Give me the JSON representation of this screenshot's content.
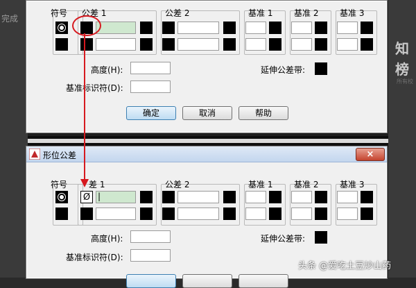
{
  "background": {
    "left_text": "完成",
    "right_text_1": "知",
    "right_text_2": "榜",
    "right_small_text": "所有校"
  },
  "labels": {
    "symbol": "符号",
    "tolerance1": "公差 1",
    "tolerance2": "公差 2",
    "datum1": "基准 1",
    "datum2": "基准 2",
    "datum3": "基准 3",
    "height": "高度(H):",
    "datum_identifier": "基准标识符(D):",
    "projected_tolerance_zone": "延伸公差带:"
  },
  "buttons": {
    "ok": "确定",
    "cancel": "取消",
    "help": "帮助"
  },
  "dialog2": {
    "title": "形位公差",
    "close": "×",
    "tolerance1_prefix": "差 1",
    "diameter_symbol": "Ø",
    "tolerance1_value": "|"
  },
  "watermark": "头条 @爱吃土豆炒山药",
  "colors": {
    "annotation": "#d6191f",
    "active_field": "#cfe8cf"
  }
}
